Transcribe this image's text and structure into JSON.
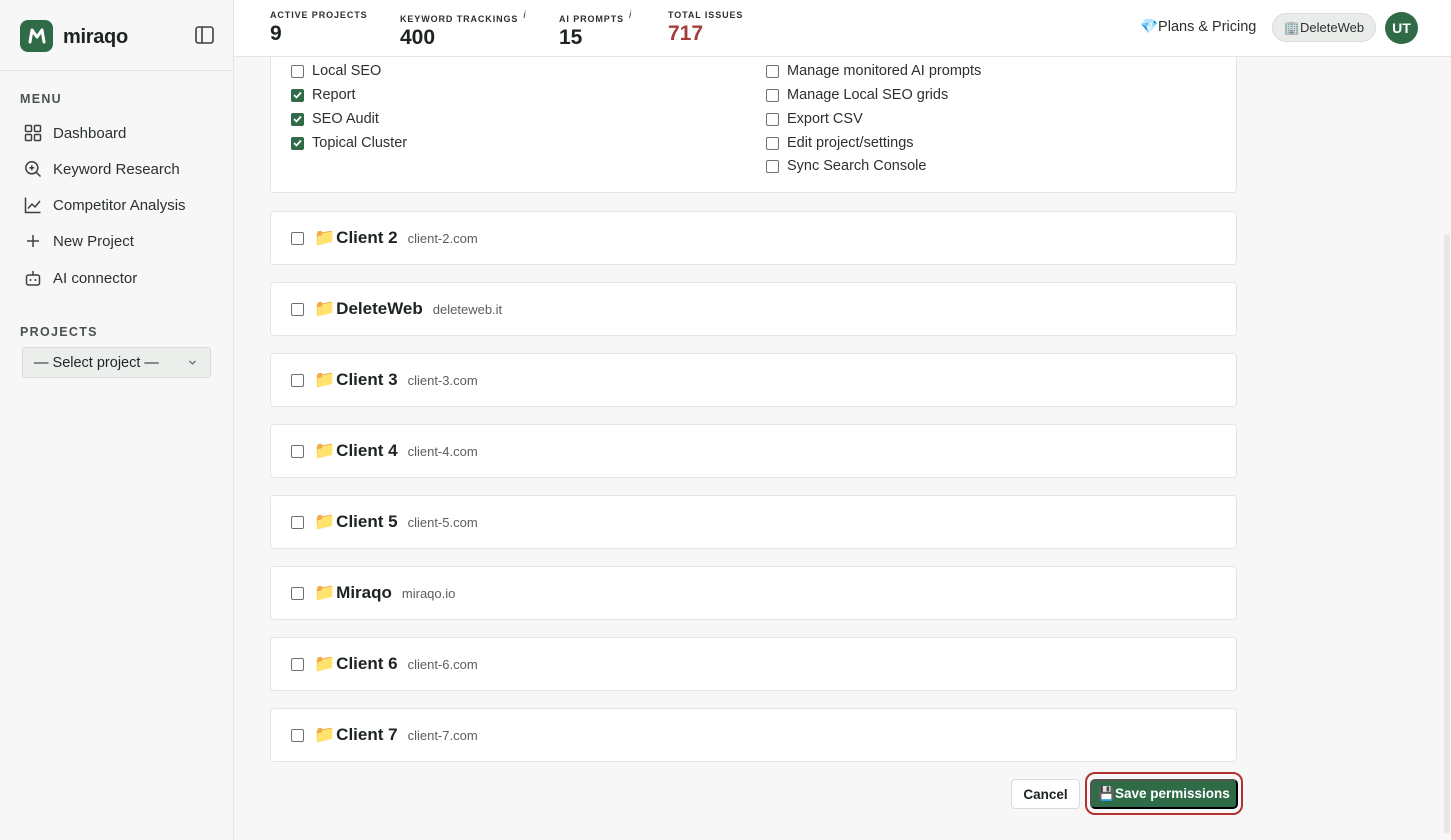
{
  "app": {
    "name": "miraqo",
    "accent": "#2f6b47",
    "danger": "#a43e3b"
  },
  "sidebar": {
    "menu_label": "MENU",
    "items": [
      {
        "label": "Dashboard",
        "icon": "grid-icon"
      },
      {
        "label": "Keyword Research",
        "icon": "search-icon"
      },
      {
        "label": "Competitor Analysis",
        "icon": "line-chart-icon"
      },
      {
        "label": "New Project",
        "icon": "plus-icon"
      },
      {
        "label": "AI connector",
        "icon": "robot-icon"
      }
    ],
    "projects_label": "PROJECTS",
    "project_select": "— Select project —"
  },
  "topbar": {
    "stats": [
      {
        "label": "ACTIVE PROJECTS",
        "value": "9",
        "info": ""
      },
      {
        "label": "KEYWORD TRACKINGS",
        "value": "400",
        "info": "i"
      },
      {
        "label": "AI PROMPTS",
        "value": "15",
        "info": "i"
      },
      {
        "label": "TOTAL ISSUES",
        "value": "717",
        "info": ""
      }
    ],
    "plans_link": "💎Plans & Pricing",
    "current_project": "🏢DeleteWeb",
    "avatar_initials": "UT"
  },
  "permissions": {
    "left": [
      {
        "label": "Local SEO",
        "checked": false
      },
      {
        "label": "Report",
        "checked": true
      },
      {
        "label": "SEO Audit",
        "checked": true
      },
      {
        "label": "Topical Cluster",
        "checked": true
      }
    ],
    "right": [
      {
        "label": "Manage monitored AI prompts",
        "checked": false
      },
      {
        "label": "Manage Local SEO grids",
        "checked": false
      },
      {
        "label": "Export CSV",
        "checked": false
      },
      {
        "label": "Edit project/settings",
        "checked": false
      },
      {
        "label": "Sync Search Console",
        "checked": false
      }
    ]
  },
  "projects": [
    {
      "folder": "📁",
      "name": "Client 2",
      "domain": "client-2.com"
    },
    {
      "folder": "📁",
      "name": "DeleteWeb",
      "domain": "deleteweb.it"
    },
    {
      "folder": "📁",
      "name": "Client 3",
      "domain": "client-3.com"
    },
    {
      "folder": "📁",
      "name": "Client 4",
      "domain": "client-4.com"
    },
    {
      "folder": "📁",
      "name": "Client 5",
      "domain": "client-5.com"
    },
    {
      "folder": "📁",
      "name": "Miraqo",
      "domain": "miraqo.io"
    },
    {
      "folder": "📁",
      "name": "Client 6",
      "domain": "client-6.com"
    },
    {
      "folder": "📁",
      "name": "Client 7",
      "domain": "client-7.com"
    }
  ],
  "actions": {
    "cancel": "Cancel",
    "save": "💾Save permissions"
  }
}
